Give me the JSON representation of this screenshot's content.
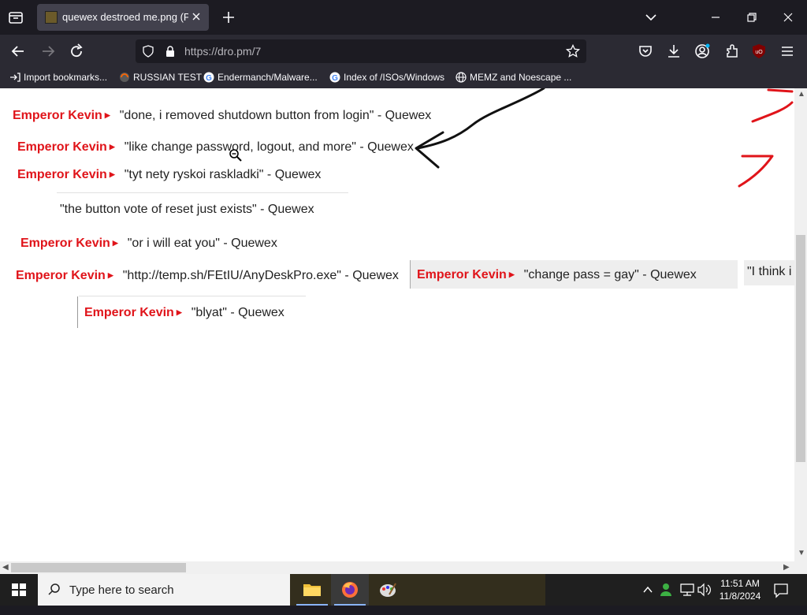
{
  "browser": {
    "tab_title": "quewex destroed me.png (PNG",
    "url": "https://dro.pm/7",
    "bookmarks": [
      {
        "label": "Import bookmarks...",
        "icon": "import-icon"
      },
      {
        "label": "RUSSIAN TEST",
        "icon": "site-favicon"
      },
      {
        "label": "Endermanch/Malware...",
        "icon": "google-icon"
      },
      {
        "label": "Index of /ISOs/Windows",
        "icon": "google-icon"
      },
      {
        "label": "MEMZ and Noescape ...",
        "icon": "globe-icon"
      }
    ]
  },
  "image_content": {
    "top_partial": "partial text line",
    "messages": [
      {
        "name": "Emperor Kevin",
        "quote": "\"done, i removed shutdown button from login\" - Quewex"
      },
      {
        "name": "Emperor Kevin",
        "quote": "\"like change password, logout, and more\" - Quewex"
      },
      {
        "name": "Emperor Kevin",
        "quote": "\"tyt nety ryskoi raskladki\" - Quewex"
      },
      {
        "name": "",
        "quote": "\"the button vote of reset just exists\" - Quewex"
      },
      {
        "name": "Emperor Kevin",
        "quote": "\"or i will eat you\" - Quewex"
      },
      {
        "name": "Emperor Kevin",
        "quote": "\"http://temp.sh/FEtIU/AnyDeskPro.exe\" - Quewex"
      },
      {
        "name": "Emperor Kevin",
        "quote": "\"change pass = gay\" - Quewex"
      },
      {
        "name": "",
        "quote": "\"I think i"
      },
      {
        "name": "Emperor Kevin",
        "quote": "\"blyat\" - Quewex"
      }
    ]
  },
  "taskbar": {
    "search_placeholder": "Type here to search",
    "time": "11:51 AM",
    "date": "11/8/2024"
  },
  "colors": {
    "accent_red": "#e0141a",
    "browser_dark": "#1c1b22"
  }
}
